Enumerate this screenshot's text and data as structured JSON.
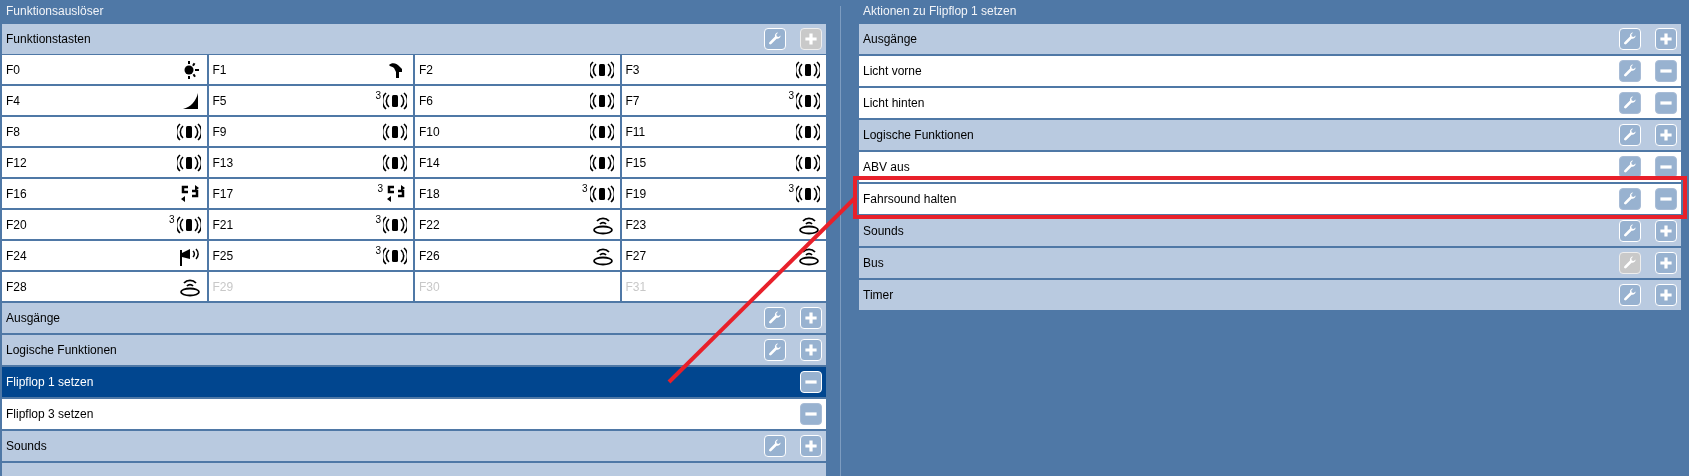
{
  "left_panel": {
    "title": "Funktionsauslöser",
    "function_keys": {
      "label": "Funktionstasten",
      "buttons": [
        {
          "kind": "edit",
          "disabled": false
        },
        {
          "kind": "add",
          "disabled": true
        }
      ],
      "keys": [
        {
          "label": "F0",
          "disabled": false
        },
        {
          "label": "F1",
          "disabled": false
        },
        {
          "label": "F2",
          "disabled": false
        },
        {
          "label": "F3",
          "disabled": false
        },
        {
          "label": "F4",
          "disabled": false
        },
        {
          "label": "F5",
          "disabled": false,
          "badge": "3"
        },
        {
          "label": "F6",
          "disabled": false
        },
        {
          "label": "F7",
          "disabled": false,
          "badge": "3"
        },
        {
          "label": "F8",
          "disabled": false
        },
        {
          "label": "F9",
          "disabled": false
        },
        {
          "label": "F10",
          "disabled": false
        },
        {
          "label": "F11",
          "disabled": false
        },
        {
          "label": "F12",
          "disabled": false
        },
        {
          "label": "F13",
          "disabled": false
        },
        {
          "label": "F14",
          "disabled": false
        },
        {
          "label": "F15",
          "disabled": false
        },
        {
          "label": "F16",
          "disabled": false
        },
        {
          "label": "F17",
          "disabled": false,
          "badge": "3"
        },
        {
          "label": "F18",
          "disabled": false,
          "badge": "3"
        },
        {
          "label": "F19",
          "disabled": false,
          "badge": "3"
        },
        {
          "label": "F20",
          "disabled": false,
          "badge": "3"
        },
        {
          "label": "F21",
          "disabled": false,
          "badge": "3"
        },
        {
          "label": "F22",
          "disabled": false
        },
        {
          "label": "F23",
          "disabled": false
        },
        {
          "label": "F24",
          "disabled": false
        },
        {
          "label": "F25",
          "disabled": false,
          "badge": "3"
        },
        {
          "label": "F26",
          "disabled": false
        },
        {
          "label": "F27",
          "disabled": false
        },
        {
          "label": "F28",
          "disabled": false
        },
        {
          "label": "F29",
          "disabled": true
        },
        {
          "label": "F30",
          "disabled": true
        },
        {
          "label": "F31",
          "disabled": true
        }
      ]
    },
    "rows": [
      {
        "kind": "group",
        "label": "Ausgänge",
        "buttons": [
          {
            "kind": "edit",
            "disabled": false
          },
          {
            "kind": "add",
            "disabled": false
          }
        ]
      },
      {
        "kind": "group",
        "label": "Logische Funktionen",
        "buttons": [
          {
            "kind": "edit",
            "disabled": false
          },
          {
            "kind": "add",
            "disabled": false
          }
        ]
      },
      {
        "kind": "item",
        "label": "Flipflop 1 setzen",
        "selected": true,
        "highlighted": false,
        "buttons": [
          {
            "kind": "remove",
            "disabled": false
          }
        ]
      },
      {
        "kind": "item",
        "label": "Flipflop 3 setzen",
        "selected": false,
        "highlighted": false,
        "buttons": [
          {
            "kind": "remove",
            "disabled": false
          }
        ]
      },
      {
        "kind": "group",
        "label": "Sounds",
        "buttons": [
          {
            "kind": "edit",
            "disabled": false
          },
          {
            "kind": "add",
            "disabled": false
          }
        ]
      },
      {
        "kind": "group"
      }
    ]
  },
  "right_panel": {
    "title": "Aktionen zu Flipflop 1 setzen",
    "rows": [
      {
        "kind": "group",
        "label": "Ausgänge",
        "buttons": [
          {
            "kind": "edit",
            "disabled": false
          },
          {
            "kind": "add",
            "disabled": false
          }
        ]
      },
      {
        "kind": "item",
        "label": "Licht vorne",
        "selected": false,
        "highlighted": false,
        "buttons": [
          {
            "kind": "edit",
            "disabled": false
          },
          {
            "kind": "remove",
            "disabled": false
          }
        ]
      },
      {
        "kind": "item",
        "label": "Licht hinten",
        "selected": false,
        "highlighted": false,
        "buttons": [
          {
            "kind": "edit",
            "disabled": false
          },
          {
            "kind": "remove",
            "disabled": false
          }
        ]
      },
      {
        "kind": "group",
        "label": "Logische Funktionen",
        "buttons": [
          {
            "kind": "edit",
            "disabled": false
          },
          {
            "kind": "add",
            "disabled": false
          }
        ]
      },
      {
        "kind": "item",
        "label": "ABV aus",
        "selected": false,
        "highlighted": false,
        "buttons": [
          {
            "kind": "edit",
            "disabled": false
          },
          {
            "kind": "remove",
            "disabled": false
          }
        ]
      },
      {
        "kind": "item",
        "label": "Fahrsound halten",
        "selected": false,
        "highlighted": true,
        "buttons": [
          {
            "kind": "edit",
            "disabled": false
          },
          {
            "kind": "remove",
            "disabled": false
          }
        ]
      },
      {
        "kind": "group",
        "label": "Sounds",
        "buttons": [
          {
            "kind": "edit",
            "disabled": false
          },
          {
            "kind": "add",
            "disabled": false
          }
        ]
      },
      {
        "kind": "group",
        "label": "Bus",
        "buttons": [
          {
            "kind": "edit",
            "disabled": true
          },
          {
            "kind": "add",
            "disabled": false
          }
        ]
      },
      {
        "kind": "group",
        "label": "Timer",
        "buttons": [
          {
            "kind": "edit",
            "disabled": false
          },
          {
            "kind": "add",
            "disabled": false
          }
        ]
      }
    ]
  },
  "annotation": {
    "kind": "line"
  }
}
